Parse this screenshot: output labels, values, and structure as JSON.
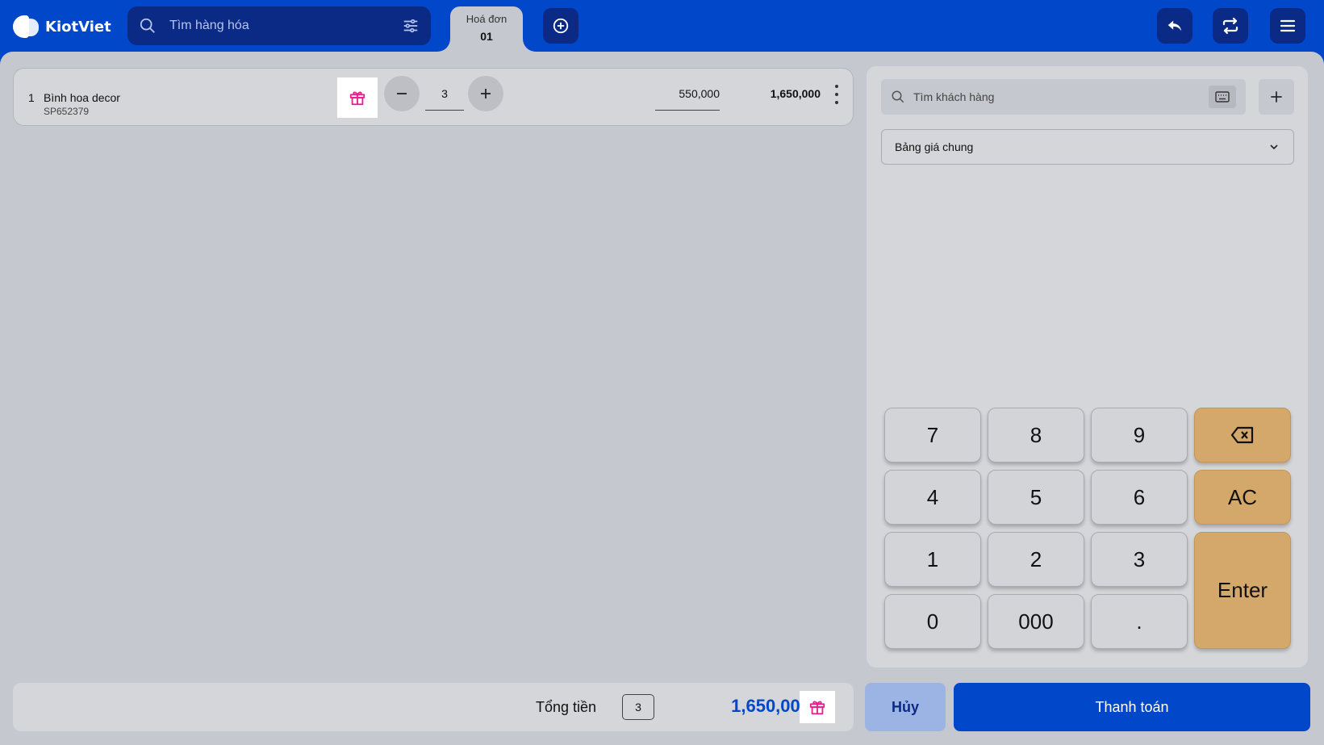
{
  "app": {
    "brand": "KiotViet"
  },
  "header": {
    "search_placeholder": "Tìm hàng hóa",
    "tab": {
      "label": "Hoá đơn",
      "number": "01"
    }
  },
  "cart": {
    "items": [
      {
        "index": "1",
        "name": "Bình hoa decor",
        "code": "SP652379",
        "quantity": "3",
        "price": "550,000",
        "total": "1,650,000"
      }
    ]
  },
  "footer": {
    "total_label": "Tổng tiền",
    "total_quantity": "3",
    "total_amount": "1,650,000"
  },
  "customer": {
    "search_placeholder": "Tìm khách hàng"
  },
  "price_list": {
    "selected": "Bảng giá chung"
  },
  "keypad": {
    "keys": [
      "7",
      "8",
      "9",
      "4",
      "5",
      "6",
      "1",
      "2",
      "3",
      "0",
      "000",
      "."
    ],
    "clear": "AC",
    "enter": "Enter"
  },
  "actions": {
    "cancel": "Hủy",
    "pay": "Thanh toán"
  },
  "colors": {
    "primary": "#0047c9",
    "dark_primary": "#0a2a86",
    "gift": "#e91e8c",
    "keypad_accent": "#d4a86a"
  },
  "icons": [
    "search-icon",
    "filter-icon",
    "add-tab-icon",
    "undo-icon",
    "sync-icon",
    "menu-icon",
    "gift-icon",
    "minus-icon",
    "plus-icon",
    "more-icon",
    "keyboard-icon",
    "add-customer-icon",
    "chevron-down-icon",
    "backspace-icon"
  ]
}
